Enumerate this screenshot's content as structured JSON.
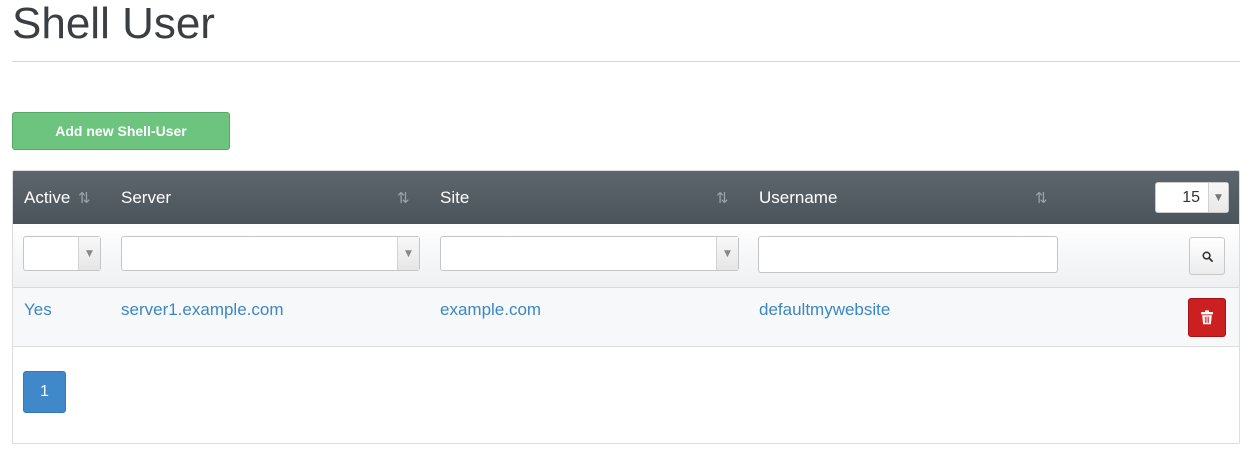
{
  "page": {
    "title": "Shell User"
  },
  "toolbar": {
    "add_label": "Add new Shell-User"
  },
  "table": {
    "columns": [
      {
        "label": "Active"
      },
      {
        "label": "Server"
      },
      {
        "label": "Site"
      },
      {
        "label": "Username"
      }
    ],
    "sort_glyph": "⇅",
    "per_page": "15",
    "filters": {
      "active": "",
      "server": "",
      "site": "",
      "username": ""
    },
    "rows": [
      {
        "active": "Yes",
        "server": "server1.example.com",
        "site": "example.com",
        "username": "defaultmywebsite"
      }
    ]
  },
  "pagination": {
    "current": "1"
  },
  "icons": {
    "sort": "sort-icon",
    "dropdown": "chevron-down-icon",
    "search": "search-icon",
    "delete": "trash-icon"
  },
  "colors": {
    "header_bg": "#525a61",
    "add_button": "#6cc47f",
    "link": "#3b87c4",
    "delete_button": "#cc1f1f",
    "page_active": "#3f88c9"
  }
}
